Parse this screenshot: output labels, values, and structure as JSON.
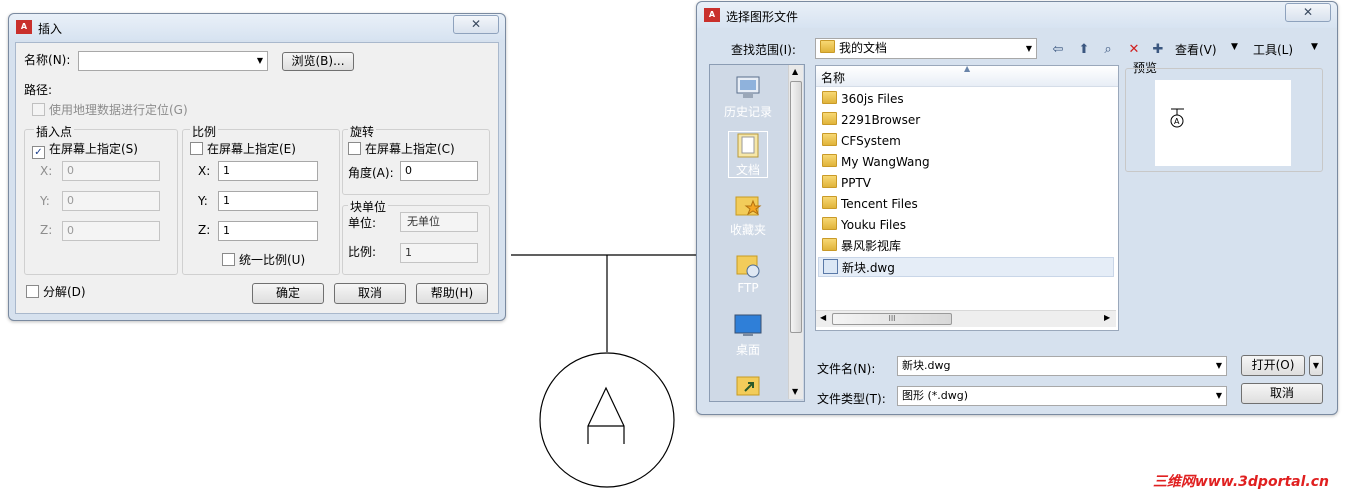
{
  "insert_dialog": {
    "title": "插入",
    "close_label": "✕",
    "name_label": "名称",
    "name_key": "(N):",
    "name_value": "",
    "browse_label": "浏览(B)...",
    "path_label": "路径:",
    "geo_label": "使用地理数据进行定位(G)",
    "insertion": {
      "title": "插入点",
      "on_screen_label": "在屏幕上指定(S)",
      "on_screen_checked": true,
      "x_label": "X:",
      "x_value": "0",
      "y_label": "Y:",
      "y_value": "0",
      "z_label": "Z:",
      "z_value": "0"
    },
    "scale": {
      "title": "比例",
      "on_screen_label": "在屏幕上指定(E)",
      "x_label": "X:",
      "x_value": "1",
      "y_label": "Y:",
      "y_value": "1",
      "z_label": "Z:",
      "z_value": "1",
      "uniform_label": "统一比例(U)"
    },
    "rotation": {
      "title": "旋转",
      "on_screen_label": "在屏幕上指定(C)",
      "angle_label": "角度(A):",
      "angle_value": "0"
    },
    "block_unit": {
      "title": "块单位",
      "unit_label": "单位:",
      "unit_value": "无单位",
      "factor_label": "比例:",
      "factor_value": "1"
    },
    "explode_label": "分解(D)",
    "ok_label": "确定",
    "cancel_label": "取消",
    "help_label": "帮助(H)"
  },
  "file_dialog": {
    "title": "选择图形文件",
    "close_label": "✕",
    "lookin_label": "查找范围(I):",
    "lookin_value": "我的文档",
    "views_label": "查看(V)",
    "tools_label": "工具(L)",
    "places": [
      {
        "label": "历史记录",
        "icon": "history-icon"
      },
      {
        "label": "文档",
        "icon": "documents-icon"
      },
      {
        "label": "收藏夹",
        "icon": "favorites-icon"
      },
      {
        "label": "FTP",
        "icon": "ftp-icon"
      },
      {
        "label": "桌面",
        "icon": "desktop-icon"
      }
    ],
    "column_header": "名称",
    "files": [
      {
        "name": "360js Files",
        "type": "folder"
      },
      {
        "name": "2291Browser",
        "type": "folder"
      },
      {
        "name": "CFSystem",
        "type": "folder"
      },
      {
        "name": "My WangWang",
        "type": "folder"
      },
      {
        "name": "PPTV",
        "type": "folder"
      },
      {
        "name": "Tencent Files",
        "type": "folder"
      },
      {
        "name": "Youku Files",
        "type": "folder"
      },
      {
        "name": "暴风影视库",
        "type": "folder"
      },
      {
        "name": "新块.dwg",
        "type": "dwg"
      }
    ],
    "preview_label": "预览",
    "filename_label": "文件名(N):",
    "filename_value": "新块.dwg",
    "filetype_label": "文件类型(T):",
    "filetype_value": "图形 (*.dwg)",
    "open_label": "打开(O)",
    "cancel_label": "取消"
  },
  "drawing": {
    "symbol_letter": "A"
  },
  "watermark": "三维网www.3dportal.cn"
}
